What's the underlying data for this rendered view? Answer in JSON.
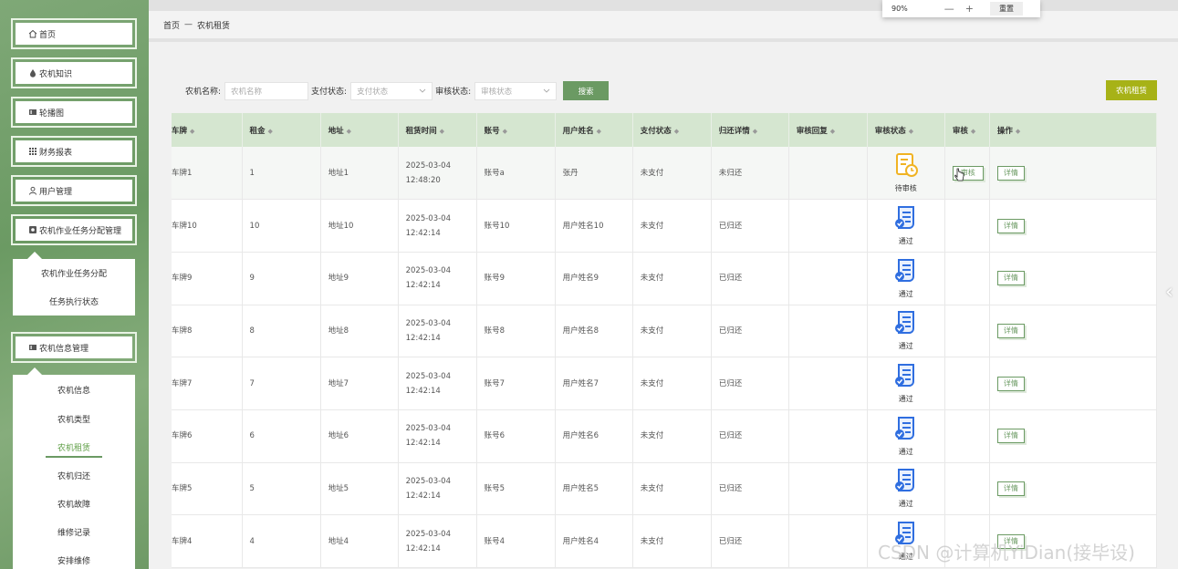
{
  "sidebar": {
    "items": [
      {
        "label": "首页",
        "icon": "home-icon"
      },
      {
        "label": "农机知识",
        "icon": "drop-icon"
      },
      {
        "label": "轮播图",
        "icon": "image-icon"
      },
      {
        "label": "财务报表",
        "icon": "grid-icon"
      },
      {
        "label": "用户管理",
        "icon": "user-icon"
      },
      {
        "label": "农机作业任务分配管理",
        "icon": "task-icon"
      }
    ],
    "task_submenu": [
      "农机作业任务分配",
      "任务执行状态"
    ],
    "info_menu": {
      "label": "农机信息管理",
      "icon": "book-icon"
    },
    "info_submenu": [
      "农机信息",
      "农机类型",
      "农机租赁",
      "农机归还",
      "农机故障",
      "维修记录",
      "安排维修"
    ],
    "active_sub": "农机租赁"
  },
  "zoom_popup": {
    "level": "90%",
    "minus": "—",
    "plus": "+",
    "reset_label": "重置"
  },
  "breadcrumb": {
    "home": "首页",
    "sep": "—",
    "current": "农机租赁"
  },
  "search": {
    "name_label": "农机名称:",
    "name_placeholder": "农机名称",
    "pay_label": "支付状态:",
    "pay_placeholder": "支付状态",
    "audit_label": "审核状态:",
    "audit_placeholder": "审核状态",
    "search_button": "搜索"
  },
  "rent_button": "农机租赁",
  "table": {
    "headers": [
      "车牌",
      "租金",
      "地址",
      "租赁时间",
      "账号",
      "用户姓名",
      "支付状态",
      "归还详情",
      "审核回复",
      "审核状态",
      "审核",
      "操作"
    ],
    "rows": [
      {
        "plate": "车牌1",
        "rent": "1",
        "addr": "地址1",
        "time": "2025-03-04 12:48:20",
        "account": "账号a",
        "name": "张丹",
        "pay": "未支付",
        "return": "未归还",
        "reply": "",
        "status": "待审核",
        "status_type": "pending",
        "audit": "审核",
        "op": "详情"
      },
      {
        "plate": "车牌10",
        "rent": "10",
        "addr": "地址10",
        "time": "2025-03-04 12:42:14",
        "account": "账号10",
        "name": "用户姓名10",
        "pay": "未支付",
        "return": "已归还",
        "reply": "",
        "status": "通过",
        "status_type": "passed",
        "audit": "",
        "op": "详情"
      },
      {
        "plate": "车牌9",
        "rent": "9",
        "addr": "地址9",
        "time": "2025-03-04 12:42:14",
        "account": "账号9",
        "name": "用户姓名9",
        "pay": "未支付",
        "return": "已归还",
        "reply": "",
        "status": "通过",
        "status_type": "passed",
        "audit": "",
        "op": "详情"
      },
      {
        "plate": "车牌8",
        "rent": "8",
        "addr": "地址8",
        "time": "2025-03-04 12:42:14",
        "account": "账号8",
        "name": "用户姓名8",
        "pay": "未支付",
        "return": "已归还",
        "reply": "",
        "status": "通过",
        "status_type": "passed",
        "audit": "",
        "op": "详情"
      },
      {
        "plate": "车牌7",
        "rent": "7",
        "addr": "地址7",
        "time": "2025-03-04 12:42:14",
        "account": "账号7",
        "name": "用户姓名7",
        "pay": "未支付",
        "return": "已归还",
        "reply": "",
        "status": "通过",
        "status_type": "passed",
        "audit": "",
        "op": "详情"
      },
      {
        "plate": "车牌6",
        "rent": "6",
        "addr": "地址6",
        "time": "2025-03-04 12:42:14",
        "account": "账号6",
        "name": "用户姓名6",
        "pay": "未支付",
        "return": "已归还",
        "reply": "",
        "status": "通过",
        "status_type": "passed",
        "audit": "",
        "op": "详情"
      },
      {
        "plate": "车牌5",
        "rent": "5",
        "addr": "地址5",
        "time": "2025-03-04 12:42:14",
        "account": "账号5",
        "name": "用户姓名5",
        "pay": "未支付",
        "return": "已归还",
        "reply": "",
        "status": "通过",
        "status_type": "passed",
        "audit": "",
        "op": "详情"
      },
      {
        "plate": "车牌4",
        "rent": "4",
        "addr": "地址4",
        "time": "2025-03-04 12:42:14",
        "account": "账号4",
        "name": "用户姓名4",
        "pay": "未支付",
        "return": "已归还",
        "reply": "",
        "status": "通过",
        "status_type": "passed",
        "audit": "",
        "op": "详情"
      }
    ]
  },
  "watermark": "CSDN @计算机YiDian(接毕设)",
  "colors": {
    "primary": "#6b9a63",
    "rent_button": "#a7b217",
    "header_bg": "#d5e6d0"
  }
}
